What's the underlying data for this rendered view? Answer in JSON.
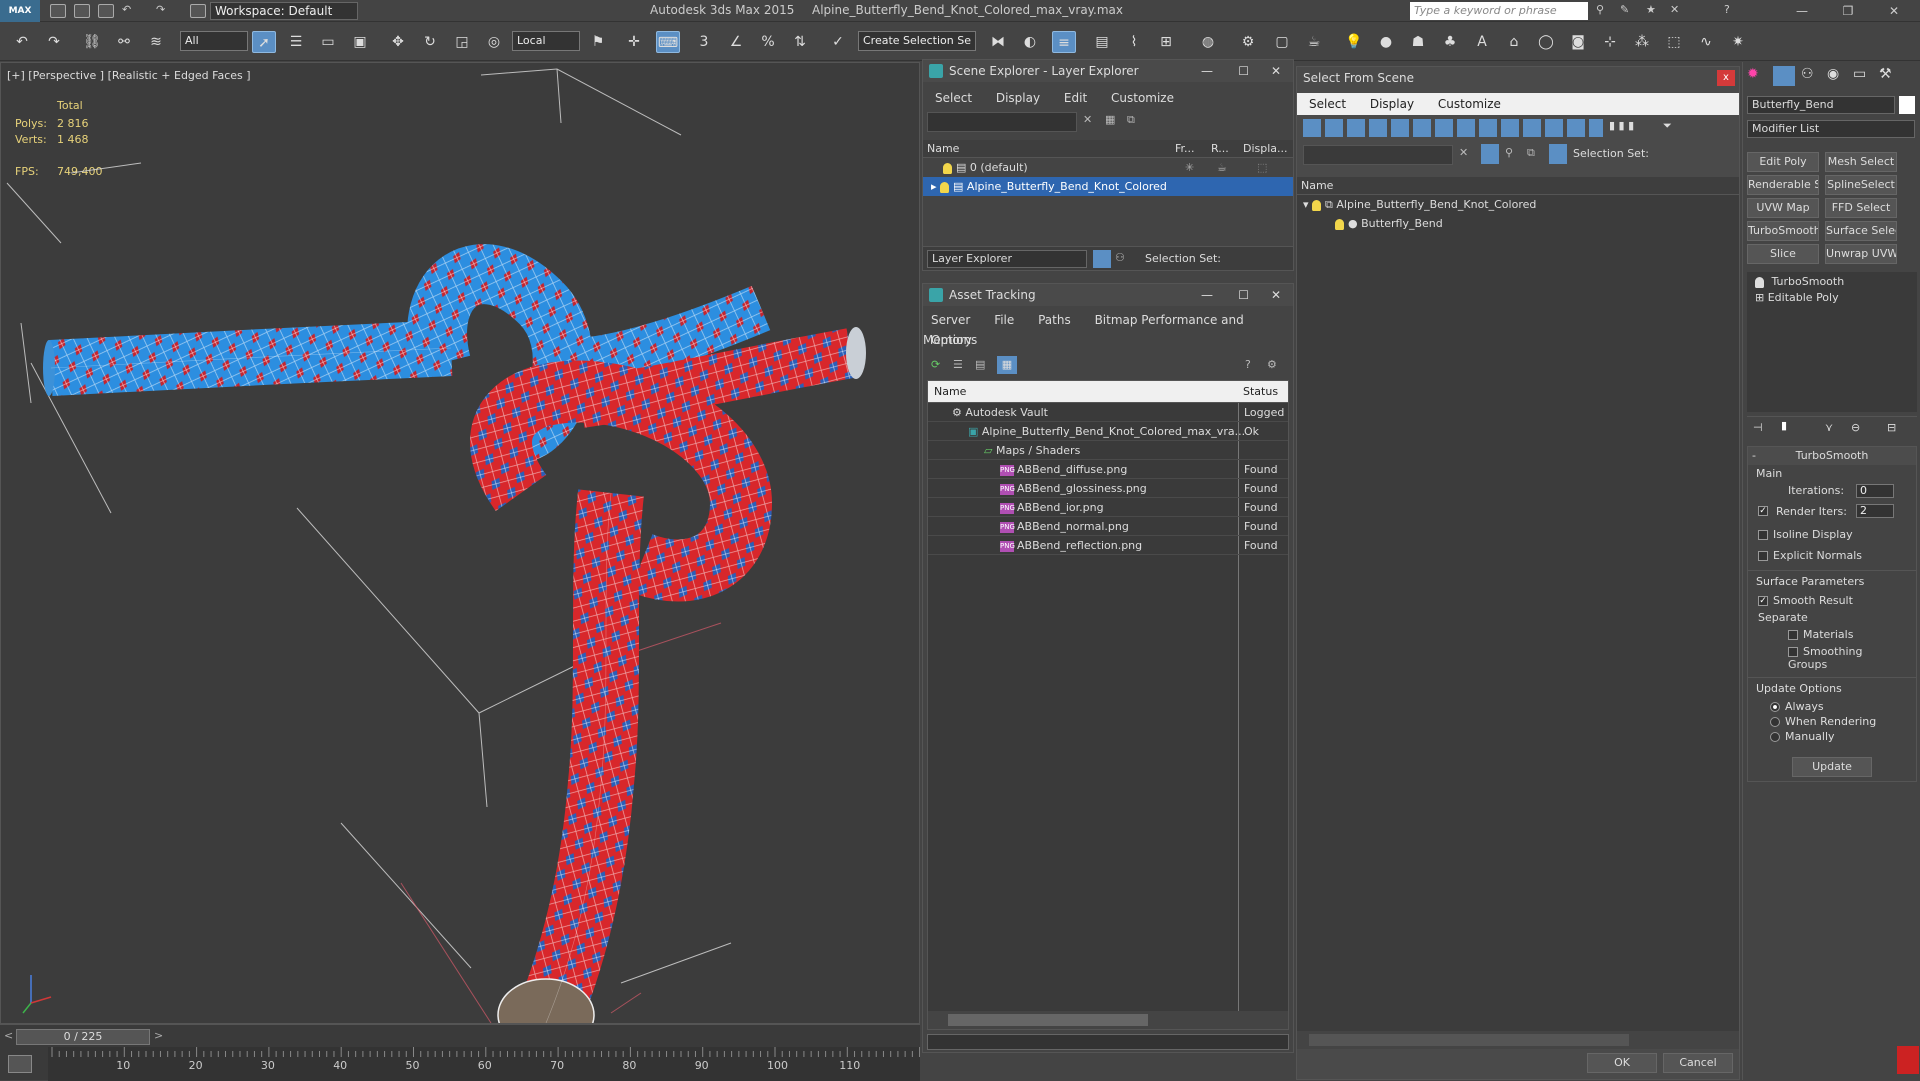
{
  "titlebar": {
    "logo": "MAX",
    "workspace": "Workspace: Default",
    "app_title": "Autodesk 3ds Max  2015",
    "file_title": "Alpine_Butterfly_Bend_Knot_Colored_max_vray.max",
    "search_placeholder": "Type a keyword or phrase"
  },
  "toolbar": {
    "selection_filter": "All",
    "ref_coord": "Local",
    "selection_set": "Create Selection Se"
  },
  "viewport": {
    "label": "[+] [Perspective ] [Realistic + Edged Faces ]",
    "total_label": "Total",
    "polys_label": "Polys:",
    "polys_value": "2 816",
    "verts_label": "Verts:",
    "verts_value": "1 468",
    "fps_label": "FPS:",
    "fps_value": "749,400"
  },
  "timeline": {
    "frame": "0 / 225",
    "ticks": [
      "10",
      "20",
      "30",
      "40",
      "50",
      "60",
      "70",
      "80",
      "90",
      "100",
      "110"
    ]
  },
  "scene_explorer": {
    "title": "Scene Explorer - Layer Explorer",
    "menu": [
      "Select",
      "Display",
      "Edit",
      "Customize"
    ],
    "columns": [
      "Name",
      "Fr...",
      "R...",
      "Displa..."
    ],
    "rows": [
      {
        "name": "0 (default)"
      },
      {
        "name": "Alpine_Butterfly_Bend_Knot_Colored"
      }
    ],
    "footer_dropdown": "Layer Explorer",
    "footer_label": "Selection Set:"
  },
  "asset_tracking": {
    "title": "Asset Tracking",
    "menu": [
      "Server",
      "File",
      "Paths",
      "Bitmap Performance and Memory"
    ],
    "menu2": "Options",
    "columns": [
      "Name",
      "Status"
    ],
    "rows": [
      {
        "name": "Autodesk Vault",
        "status": "Logged"
      },
      {
        "name": "Alpine_Butterfly_Bend_Knot_Colored_max_vra...",
        "status": "Ok"
      },
      {
        "name": "Maps / Shaders",
        "status": ""
      },
      {
        "name": "ABBend_diffuse.png",
        "status": "Found"
      },
      {
        "name": "ABBend_glossiness.png",
        "status": "Found"
      },
      {
        "name": "ABBend_ior.png",
        "status": "Found"
      },
      {
        "name": "ABBend_normal.png",
        "status": "Found"
      },
      {
        "name": "ABBend_reflection.png",
        "status": "Found"
      }
    ]
  },
  "select_from_scene": {
    "title": "Select From Scene",
    "menu": [
      "Select",
      "Display",
      "Customize"
    ],
    "selection_set_label": "Selection Set:",
    "column": "Name",
    "rows": [
      {
        "name": "Alpine_Butterfly_Bend_Knot_Colored"
      },
      {
        "name": "Butterfly_Bend"
      }
    ],
    "ok": "OK",
    "cancel": "Cancel"
  },
  "command_panel": {
    "object_name": "Butterfly_Bend",
    "modifier_list": "Modifier List",
    "mod_buttons": [
      "Edit Poly",
      "Mesh Select",
      "Renderable Spline",
      "SplineSelect",
      "UVW Map",
      "FFD Select",
      "TurboSmooth",
      "Surface Select",
      "Slice",
      "Unwrap UVW"
    ],
    "stack": [
      "TurboSmooth",
      "Editable Poly"
    ],
    "rollout_title": "TurboSmooth",
    "main_label": "Main",
    "iterations_label": "Iterations:",
    "iterations_value": "0",
    "render_iters_label": "Render Iters:",
    "render_iters_value": "2",
    "isoline": "Isoline Display",
    "explicit_normals": "Explicit Normals",
    "surface_params": "Surface Parameters",
    "smooth_result": "Smooth Result",
    "separate": "Separate",
    "materials": "Materials",
    "smoothing_groups": "Smoothing Groups",
    "update_options": "Update Options",
    "always": "Always",
    "when_rendering": "When Rendering",
    "manually": "Manually",
    "update_button": "Update"
  }
}
